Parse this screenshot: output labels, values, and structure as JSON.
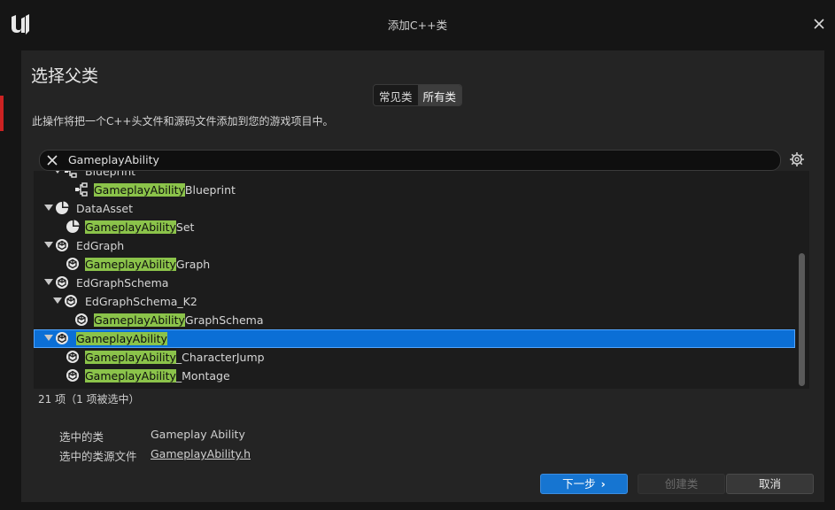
{
  "window": {
    "title": "添加C++类"
  },
  "dialog": {
    "heading": "选择父类",
    "tabs": [
      {
        "label": "常见类",
        "active": false
      },
      {
        "label": "所有类",
        "active": true
      }
    ],
    "description": "此操作将把一个C++头文件和源码文件添加到您的游戏项目中。",
    "search": {
      "value": "GameplayAbility"
    },
    "tree": {
      "highlight_color": "#8bc34a",
      "rows": [
        {
          "prefix": "",
          "match": "",
          "suffix": "Blueprint",
          "icon": "blueprint-icon"
        },
        {
          "prefix": "",
          "match": "GameplayAbility",
          "suffix": "Blueprint",
          "icon": "blueprint-icon"
        },
        {
          "prefix": "",
          "match": "",
          "suffix": "DataAsset",
          "icon": "pie-icon"
        },
        {
          "prefix": "",
          "match": "GameplayAbility",
          "suffix": "Set",
          "icon": "pie-icon"
        },
        {
          "prefix": "",
          "match": "",
          "suffix": "EdGraph",
          "icon": "class-icon"
        },
        {
          "prefix": "",
          "match": "GameplayAbility",
          "suffix": "Graph",
          "icon": "class-icon"
        },
        {
          "prefix": "",
          "match": "",
          "suffix": "EdGraphSchema",
          "icon": "class-icon"
        },
        {
          "prefix": "",
          "match": "",
          "suffix": "EdGraphSchema_K2",
          "icon": "class-icon"
        },
        {
          "prefix": "",
          "match": "GameplayAbility",
          "suffix": "GraphSchema",
          "icon": "class-icon"
        },
        {
          "prefix": "",
          "match": "GameplayAbility",
          "suffix": "",
          "icon": "class-icon",
          "selected": true
        },
        {
          "prefix": "",
          "match": "GameplayAbility",
          "suffix": "_CharacterJump",
          "icon": "class-icon"
        },
        {
          "prefix": "",
          "match": "GameplayAbility",
          "suffix": "_Montage",
          "icon": "class-icon"
        }
      ]
    },
    "count": "21 项（1 项被选中）",
    "selected_class_label": "选中的类",
    "selected_class_value": "Gameplay Ability",
    "selected_file_label": "选中的类源文件",
    "selected_file_value": "GameplayAbility.h",
    "buttons": {
      "next": "下一步",
      "create": "创建类",
      "cancel": "取消"
    }
  }
}
